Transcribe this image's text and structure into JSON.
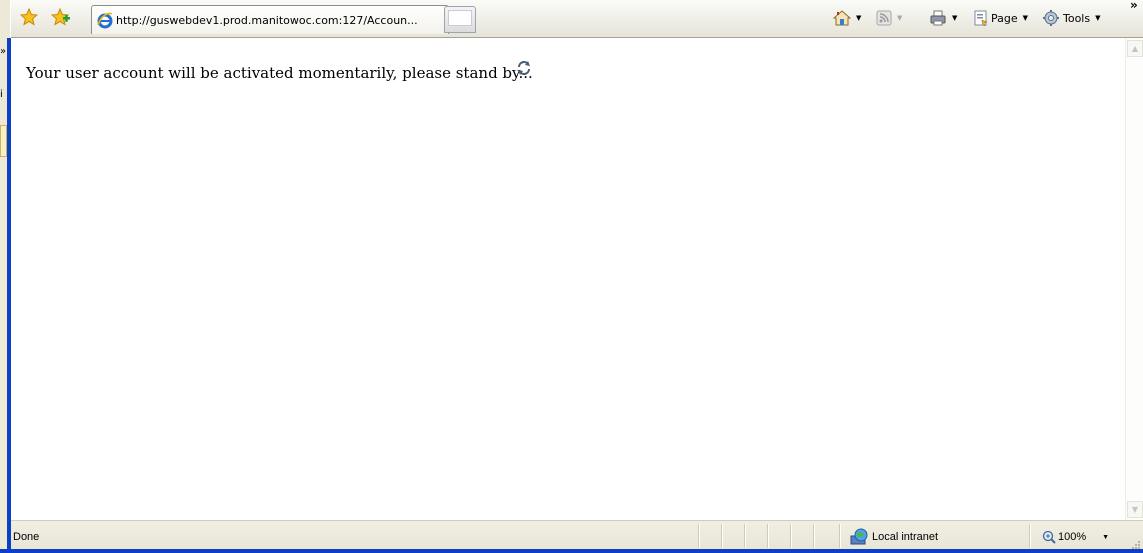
{
  "browser": {
    "tab": {
      "title": "http://guswebdev1.prod.manitowoc.com:127/Accoun..."
    },
    "commands": {
      "page_label": "Page",
      "tools_label": "Tools"
    }
  },
  "content": {
    "message": "Your user account will be activated momentarily, please stand by..."
  },
  "status_bar": {
    "status_text": "Done",
    "zone_label": "Local intranet",
    "zoom_level": "100%"
  },
  "background_window": {
    "fragment_1": "»",
    "fragment_2": "i"
  },
  "colors": {
    "window_border": "#0a3fc6",
    "toolbar_bg": "#eeede5",
    "status_bg": "#ece9d8"
  }
}
